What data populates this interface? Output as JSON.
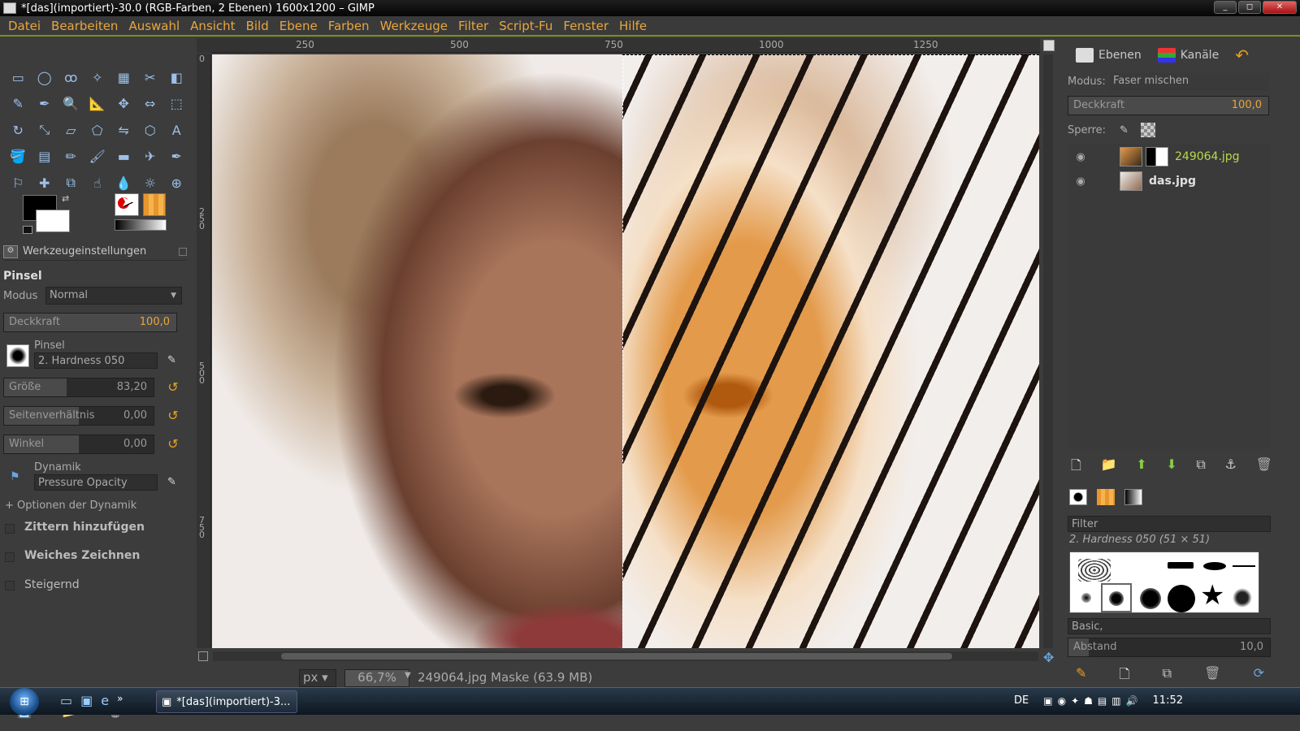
{
  "window": {
    "title": "*[das](importiert)-30.0 (RGB-Farben, 2 Ebenen) 1600x1200 – GIMP",
    "min": "_",
    "max": "◻",
    "close": "✕"
  },
  "menu": [
    "Datei",
    "Bearbeiten",
    "Auswahl",
    "Ansicht",
    "Bild",
    "Ebene",
    "Farben",
    "Werkzeuge",
    "Filter",
    "Script-Fu",
    "Fenster",
    "Hilfe"
  ],
  "tool_icons": [
    "rect-select",
    "ellipse-select",
    "free-select",
    "fuzzy-select",
    "color-select",
    "scissors",
    "foreground-select",
    "paths",
    "color-picker",
    "zoom",
    "measure",
    "move",
    "align",
    "crop",
    "rotate",
    "scale",
    "shear",
    "perspective",
    "flip",
    "cage",
    "text",
    "bucket-fill",
    "blend",
    "pencil",
    "paintbrush",
    "eraser",
    "airbrush",
    "ink",
    "clone",
    "heal",
    "perspective-clone",
    "smudge",
    "blur",
    "dodge-burn",
    "unified-transform"
  ],
  "tool_glyphs": [
    "▭",
    "◯",
    "ꝏ",
    "✧",
    "▦",
    "✂",
    "◧",
    "✎",
    "✒",
    "🔍",
    "📐",
    "✥",
    "⇔",
    "⬚",
    "↻",
    "⤡",
    "▱",
    "⬠",
    "⇋",
    "⬡",
    "A",
    "🪣",
    "▤",
    "✏",
    "🖌",
    "▬",
    "✈",
    "✒",
    "⚐",
    "✚",
    "⧉",
    "☝",
    "💧",
    "☼",
    "⊕"
  ],
  "tool_options": {
    "tab_title": "Werkzeugeinstellungen",
    "tool_name": "Pinsel",
    "mode_label": "Modus",
    "mode_value": "Normal",
    "opacity_label": "Deckkraft",
    "opacity_value": "100,0",
    "brush_label": "Pinsel",
    "brush_value": "2. Hardness 050",
    "size_label": "Größe",
    "size_value": "83,20",
    "aspect_label": "Seitenverhältnis",
    "aspect_value": "0,00",
    "angle_label": "Winkel",
    "angle_value": "0,00",
    "dynamics_label": "Dynamik",
    "dynamics_value": "Pressure Opacity",
    "dynamics_options": "+ Optionen der Dynamik",
    "jitter": "Zittern hinzufügen",
    "smooth": "Weiches Zeichnen",
    "incremental": "Steigernd"
  },
  "rulers": {
    "h": [
      "250",
      "500",
      "750",
      "1000",
      "1250"
    ],
    "v": [
      "0",
      "250",
      "500",
      "750"
    ]
  },
  "status": {
    "unit": "px",
    "zoom": "66,7%",
    "message": "249064.jpg Maske (63.9 MB)"
  },
  "layers_panel": {
    "tab_layers": "Ebenen",
    "tab_channels": "Kanäle",
    "mode_label": "Modus:",
    "mode_value": "Faser mischen",
    "opacity_label": "Deckkraft",
    "opacity_value": "100,0",
    "lock_label": "Sperre:",
    "layers": [
      {
        "name": "249064.jpg",
        "color": "#b8d84a"
      },
      {
        "name": "das.jpg",
        "color": "#e0e0e0"
      }
    ]
  },
  "brushes_panel": {
    "filter_label": "Filter",
    "current_brush": "2. Hardness 050 (51 × 51)",
    "tag": "Basic,",
    "spacing_label": "Abstand",
    "spacing_value": "10,0"
  },
  "taskbar": {
    "task_label": "*[das](importiert)-3...",
    "lang": "DE",
    "time": "11:52"
  },
  "colors": {
    "accent": "#e8a63d",
    "menu_underline": "#808e1a",
    "fg": "#000000",
    "bg": "#ffffff"
  }
}
